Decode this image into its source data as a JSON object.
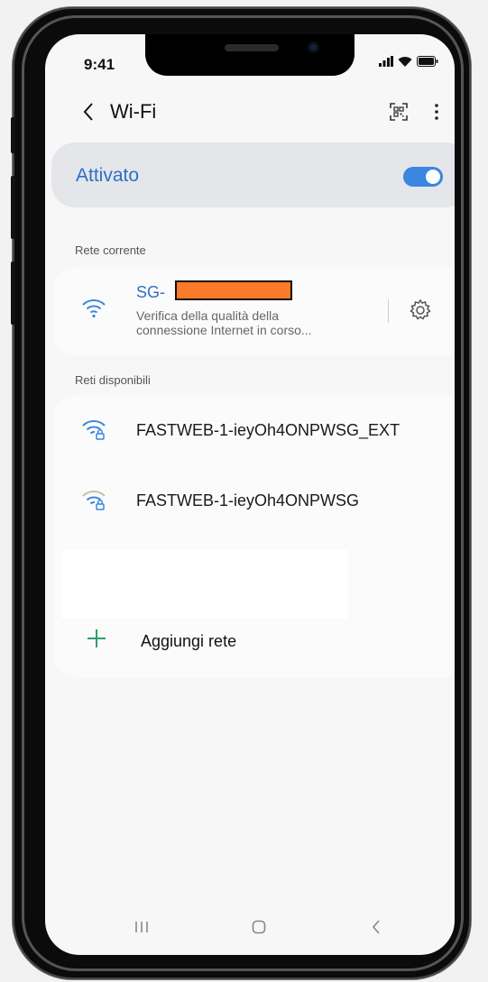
{
  "status_bar": {
    "time": "9:41"
  },
  "app_bar": {
    "title": "Wi-Fi",
    "back_icon": "chevron-left-icon",
    "qr_icon": "qr-code-scan-icon",
    "more_icon": "more-vertical-icon"
  },
  "wifi_toggle": {
    "label": "Attivato",
    "state": "on",
    "accent_color": "#3a86e0"
  },
  "current_network": {
    "section_title": "Rete corrente",
    "name_visible": "SG-",
    "status_line1": "Verifica della qualità della",
    "status_line2": "connessione Internet in corso..."
  },
  "available_networks": {
    "section_title": "Reti disponibili",
    "items": [
      {
        "name": "FASTWEB-1-ieyOh4ONPWSG_EXT",
        "secured": true,
        "signal": "full"
      },
      {
        "name": "FASTWEB-1-ieyOh4ONPWSG",
        "secured": true,
        "signal": "weak"
      }
    ]
  },
  "add_network": {
    "label": "Aggiungi rete"
  },
  "nav_bar": {
    "recents_icon": "recent-apps-icon",
    "home_icon": "home-icon",
    "back_icon": "back-icon"
  }
}
